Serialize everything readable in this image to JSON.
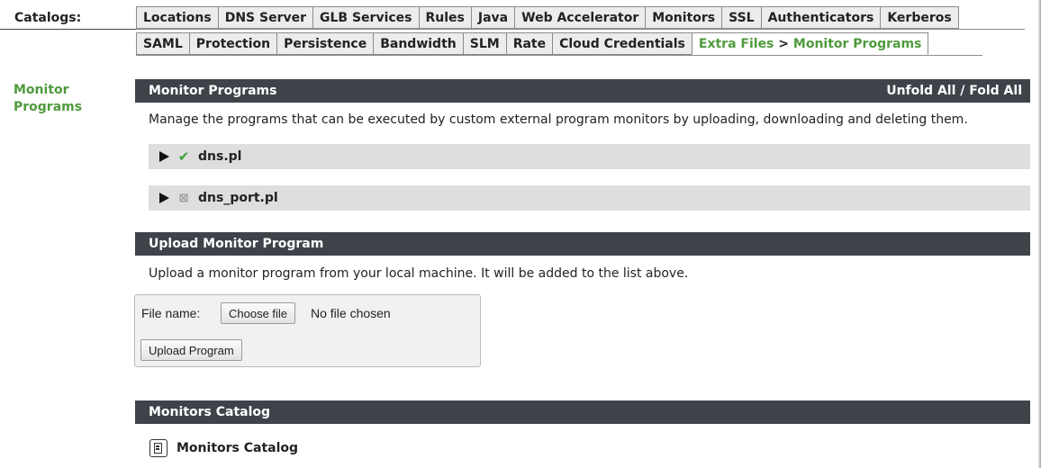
{
  "header": {
    "catalogs_label": "Catalogs:",
    "tabs_row1": [
      "Locations",
      "DNS Server",
      "GLB Services",
      "Rules",
      "Java",
      "Web Accelerator",
      "Monitors",
      "SSL",
      "Authenticators",
      "Kerberos"
    ],
    "tabs_row2": [
      "SAML",
      "Protection",
      "Persistence",
      "Bandwidth",
      "SLM",
      "Rate",
      "Cloud Credentials"
    ],
    "active_tab": {
      "parent": "Extra Files",
      "separator": ">",
      "child": "Monitor Programs"
    }
  },
  "left_title": "Monitor Programs",
  "monitor_programs": {
    "title": "Monitor Programs",
    "toggle_label": "Unfold All / Fold All",
    "description": "Manage the programs that can be executed by custom external program monitors by uploading, downloading and deleting them.",
    "programs": [
      {
        "name": "dns.pl",
        "status": "in-use",
        "status_icon": "check-icon"
      },
      {
        "name": "dns_port.pl",
        "status": "unused",
        "status_icon": "cross-icon"
      }
    ]
  },
  "upload": {
    "title": "Upload Monitor Program",
    "description": "Upload a monitor program from your local machine. It will be added to the list above.",
    "file_label": "File name:",
    "choose_button": "Choose file",
    "no_file_text": "No file chosen",
    "upload_button": "Upload Program"
  },
  "catalog": {
    "title": "Monitors Catalog",
    "link_label": "Monitors Catalog",
    "icon": "catalog-icon"
  },
  "colors": {
    "accent_green": "#4f9a3c",
    "section_bar": "#3e434a",
    "row_bg": "#dedede"
  }
}
